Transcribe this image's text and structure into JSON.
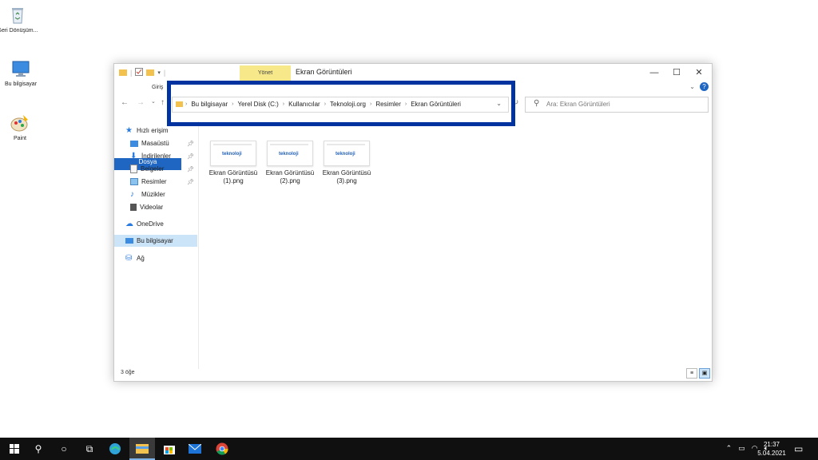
{
  "desktop": {
    "icons": [
      {
        "name": "recycle-bin",
        "label": "Geri Dönüşüm..."
      },
      {
        "name": "this-pc",
        "label": "Bu bilgisayar"
      },
      {
        "name": "paint",
        "label": "Paint"
      }
    ]
  },
  "window": {
    "manage_tab": "Yönet",
    "title": "Ekran Görüntüleri",
    "ribbon_tabs": {
      "file": "Dosya",
      "home": "Giriş"
    },
    "breadcrumbs": [
      "Bu bilgisayar",
      "Yerel Disk (C:)",
      "Kullanıcılar",
      "Teknoloji.org",
      "Resimler",
      "Ekran Görüntüleri"
    ],
    "search_placeholder": "Ara: Ekran Görüntüleri",
    "sidebar": {
      "quick_access": "Hızlı erişim",
      "items": [
        {
          "label": "Masaüstü",
          "pinned": true
        },
        {
          "label": "İndirilenler",
          "pinned": true
        },
        {
          "label": "Belgeler",
          "pinned": true
        },
        {
          "label": "Resimler",
          "pinned": true
        },
        {
          "label": "Müzikler",
          "pinned": false
        },
        {
          "label": "Videolar",
          "pinned": false
        }
      ],
      "onedrive": "OneDrive",
      "this_pc": "Bu bilgisayar",
      "network": "Ağ"
    },
    "files": [
      {
        "line1": "Ekran Görüntüsü",
        "line2": "(1).png",
        "thumb": "teknoloji"
      },
      {
        "line1": "Ekran Görüntüsü",
        "line2": "(2).png",
        "thumb": "teknoloji"
      },
      {
        "line1": "Ekran Görüntüsü",
        "line2": "(3).png",
        "thumb": "teknoloji"
      }
    ],
    "status": "3 öğe"
  },
  "taskbar": {
    "time": "21:37",
    "date": "5.04.2021"
  },
  "colors": {
    "accent": "#1e66c1",
    "highlight_box": "#0033a0",
    "manage_tab": "#f7e889",
    "taskbar": "#101010"
  }
}
